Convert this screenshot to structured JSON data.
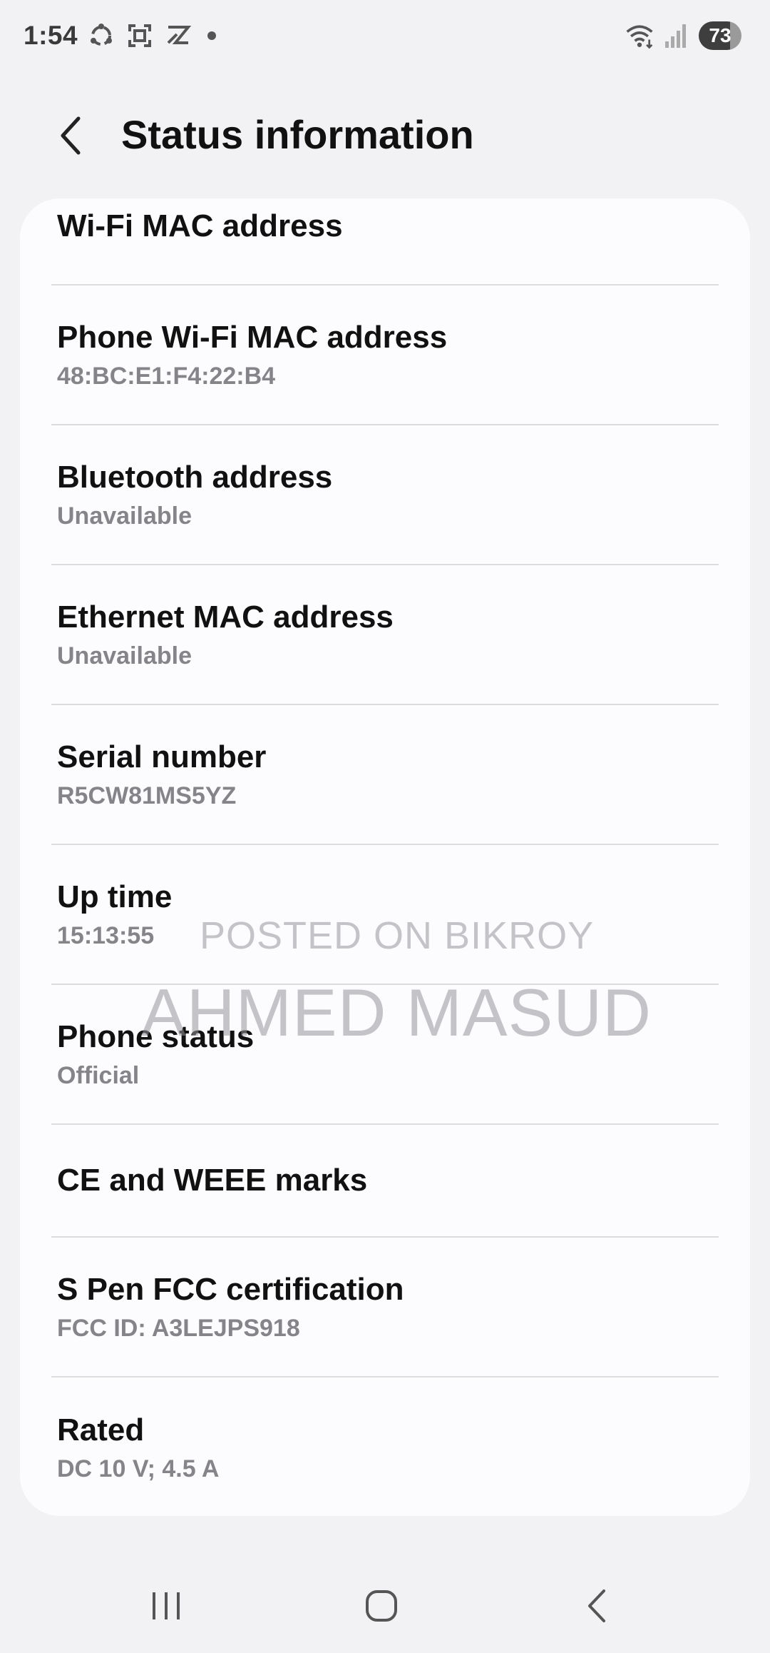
{
  "status_bar": {
    "time": "1:54",
    "battery": "73",
    "icons_left": [
      "sync-icon",
      "screenshot-icon",
      "app-notification-icon",
      "more-notifications-dot"
    ],
    "icons_right": [
      "wifi-icon",
      "cellular-signal-icon",
      "battery-icon"
    ]
  },
  "header": {
    "title": "Status information",
    "back_icon": "chevron-left-icon"
  },
  "items": [
    {
      "title": "Wi-Fi MAC address",
      "subtitle": ""
    },
    {
      "title": "Phone Wi-Fi MAC address",
      "subtitle": "48:BC:E1:F4:22:B4"
    },
    {
      "title": "Bluetooth address",
      "subtitle": "Unavailable"
    },
    {
      "title": "Ethernet MAC address",
      "subtitle": "Unavailable"
    },
    {
      "title": "Serial number",
      "subtitle": "R5CW81MS5YZ"
    },
    {
      "title": "Up time",
      "subtitle": "15:13:55"
    },
    {
      "title": "Phone status",
      "subtitle": "Official"
    },
    {
      "title": "CE and WEEE marks",
      "subtitle": ""
    },
    {
      "title": "S Pen FCC certification",
      "subtitle": "FCC ID: A3LEJPS918"
    },
    {
      "title": "Rated",
      "subtitle": "DC 10 V; 4.5 A"
    }
  ],
  "watermark": {
    "line1": "POSTED ON BIKROY",
    "line2": "AHMED MASUD"
  },
  "nav_bar": {
    "icons": [
      "recents-icon",
      "home-icon",
      "back-icon"
    ]
  },
  "colors": {
    "background": "#f2f2f4",
    "card": "#fcfcfe",
    "title_text": "#111111",
    "subtitle_text": "#858589",
    "divider": "#dcdcdf"
  }
}
